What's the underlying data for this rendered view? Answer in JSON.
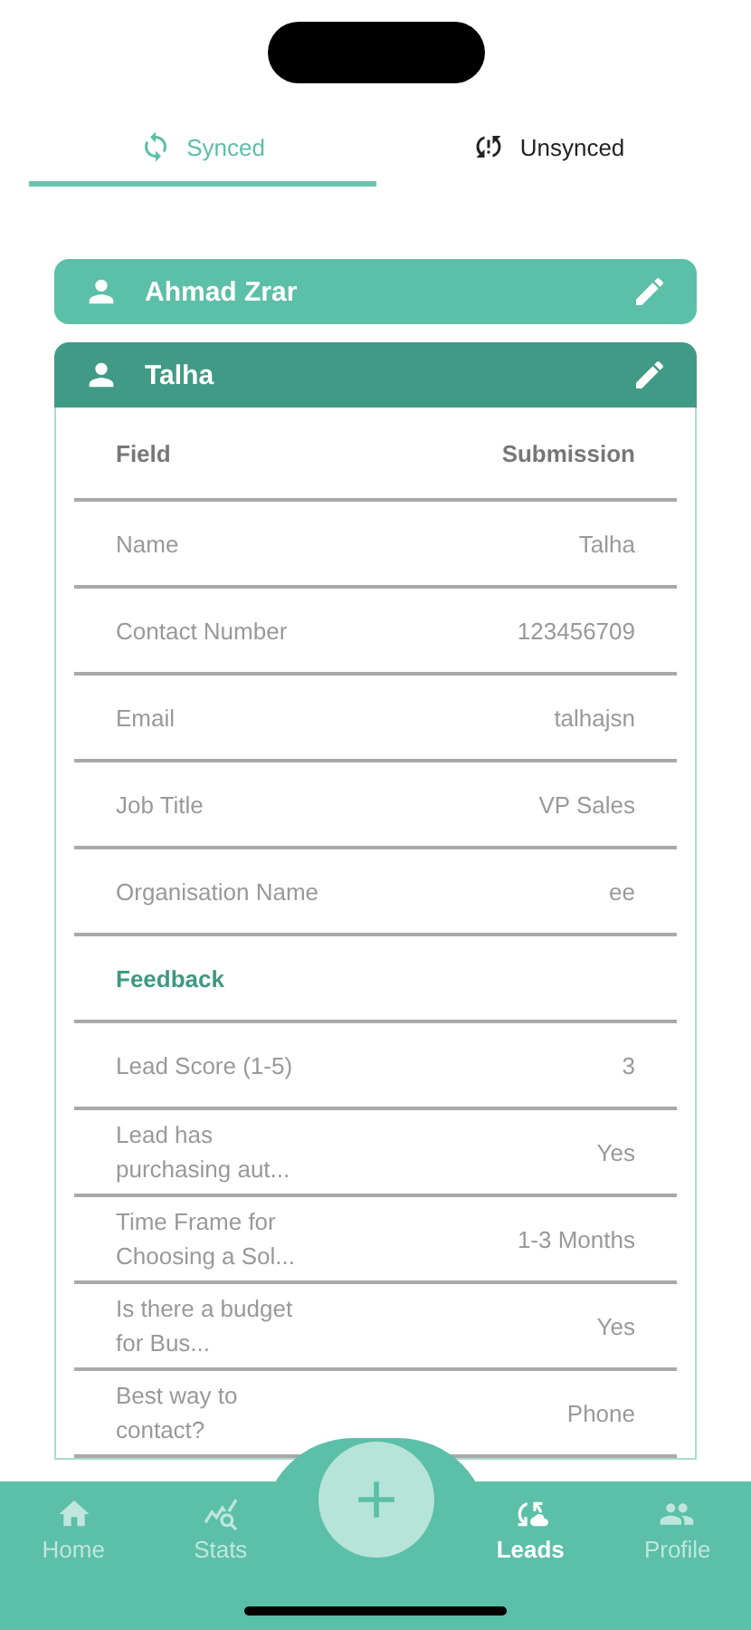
{
  "tabs": [
    {
      "label": "Synced",
      "selected": true
    },
    {
      "label": "Unsynced",
      "selected": false
    }
  ],
  "leads": [
    {
      "name": "Ahmad Zrar",
      "expanded": false
    },
    {
      "name": "Talha",
      "expanded": true,
      "columns": [
        "Field",
        "Submission"
      ],
      "rows": [
        {
          "kind": "row",
          "field": "Name",
          "value": "Talha"
        },
        {
          "kind": "row",
          "field": "Contact Number",
          "value": "123456709"
        },
        {
          "kind": "row",
          "field": "Email",
          "value": "talhajsn"
        },
        {
          "kind": "row",
          "field": "Job Title",
          "value": "VP Sales"
        },
        {
          "kind": "row",
          "field": "Organisation Name",
          "value": "ee"
        },
        {
          "kind": "section",
          "field": "Feedback"
        },
        {
          "kind": "row",
          "field": "Lead Score (1-5)",
          "value": "3"
        },
        {
          "kind": "row",
          "field": "Lead has purchasing aut...",
          "value": "Yes"
        },
        {
          "kind": "row",
          "field": "Time Frame for Choosing a Sol...",
          "value": "1-3 Months"
        },
        {
          "kind": "row",
          "field": "Is there a budget for Bus...",
          "value": "Yes"
        },
        {
          "kind": "row",
          "field": "Best way to contact?",
          "value": "Phone"
        }
      ]
    }
  ],
  "nav": [
    {
      "label": "Home",
      "selected": false
    },
    {
      "label": "Stats",
      "selected": false
    },
    {
      "label": "Leads",
      "selected": true
    },
    {
      "label": "Profile",
      "selected": false
    }
  ]
}
